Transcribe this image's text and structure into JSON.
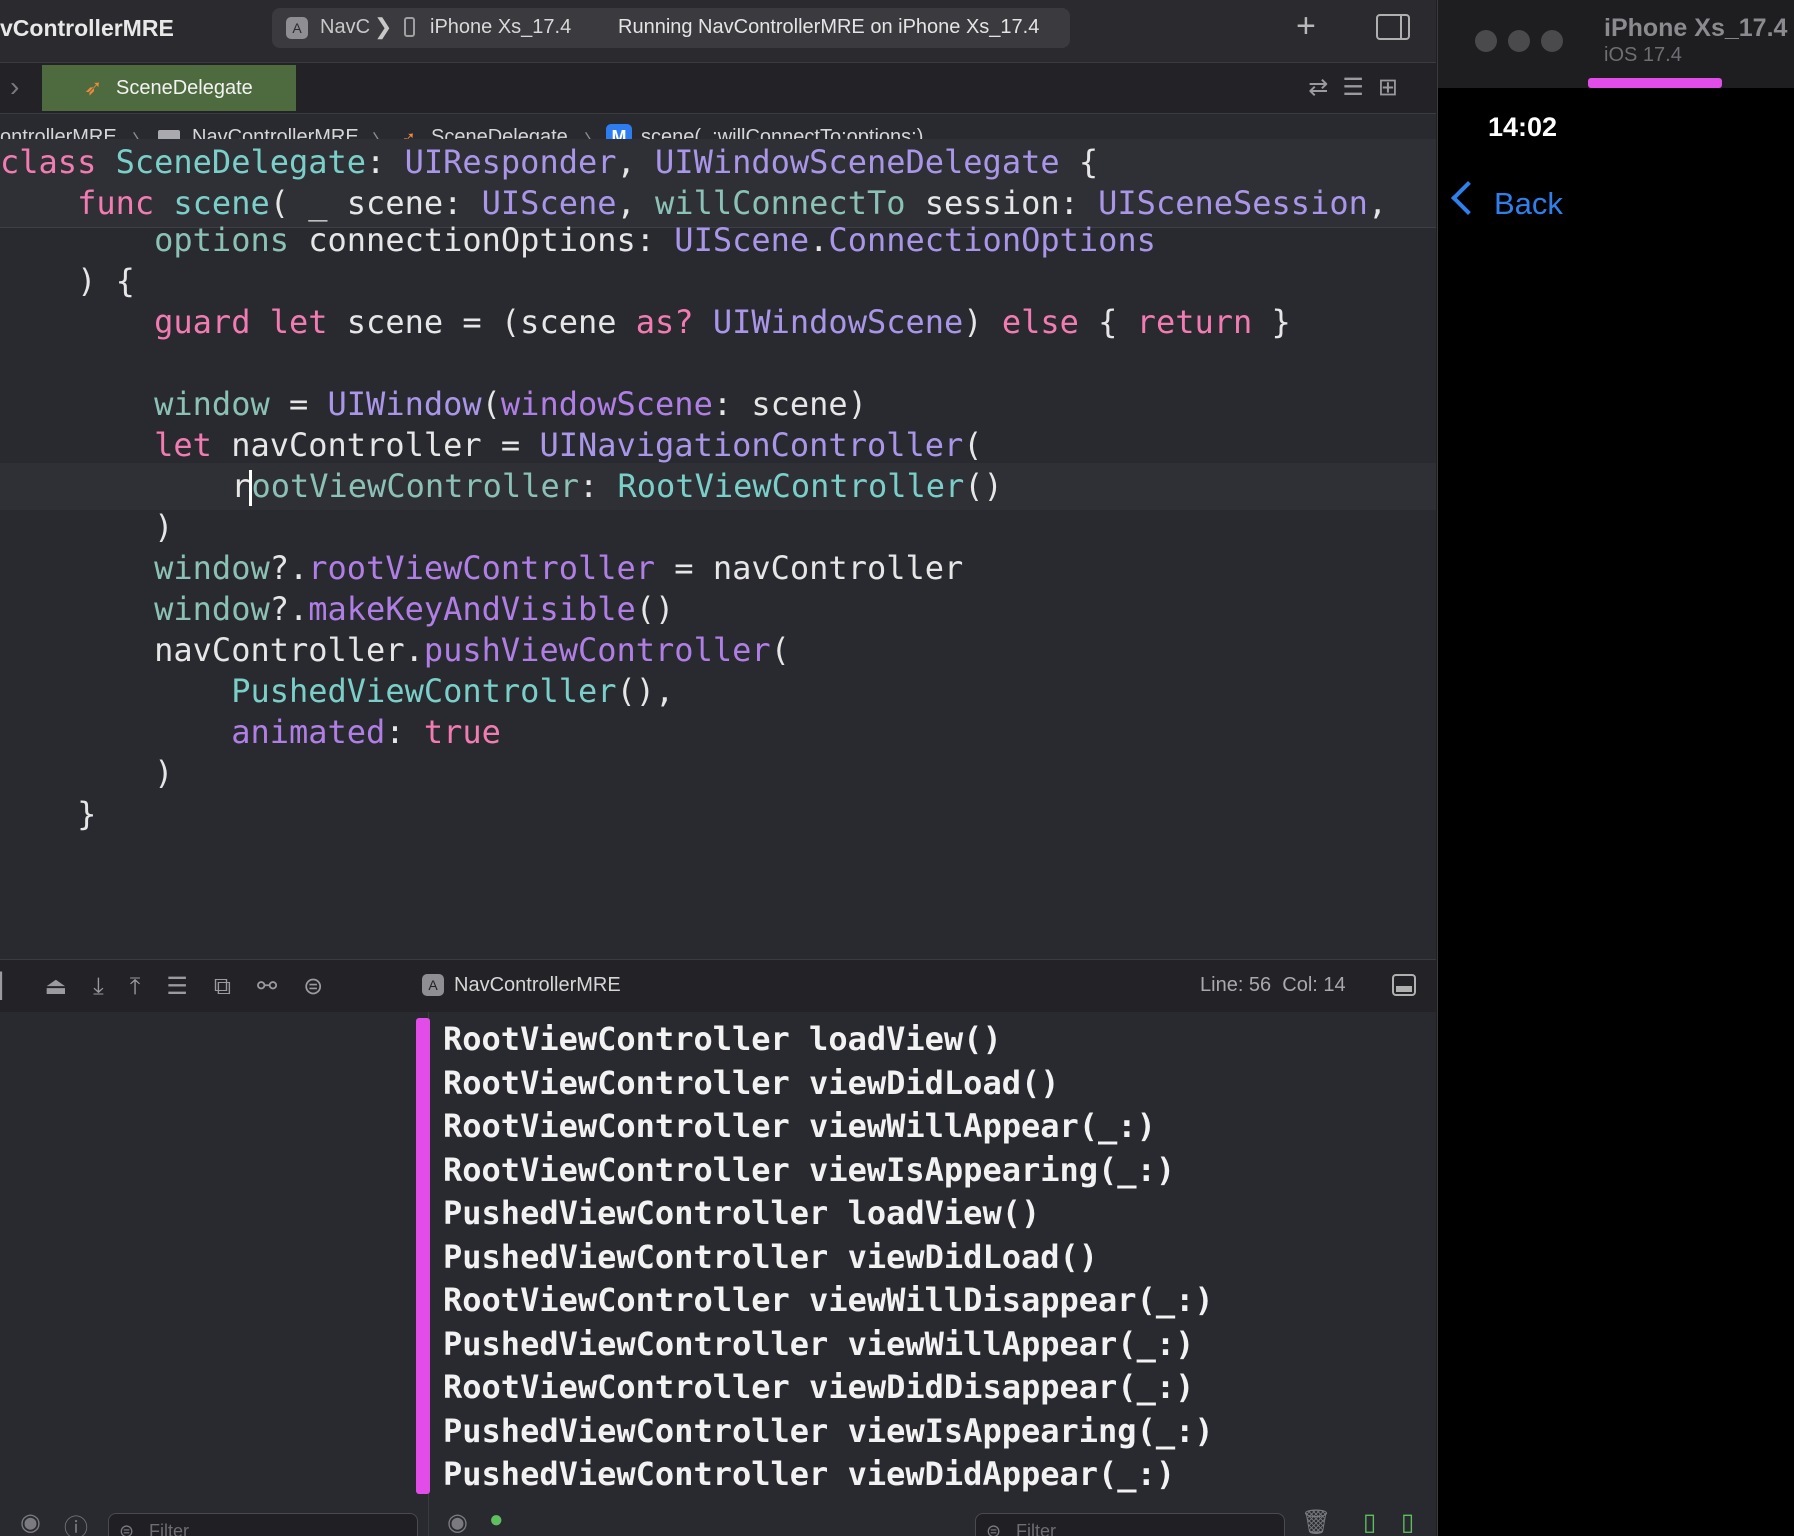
{
  "titlebar": {
    "app_title": "vControllerMRE",
    "scheme": "NavC",
    "scheme_chevron": "❯",
    "destination": "iPhone Xs_17.4",
    "status": "Running NavControllerMRE on iPhone Xs_17.4",
    "icons": [
      "app-scheme-icon",
      "iphone-icon",
      "plus-icon",
      "inspector-toggle-icon"
    ]
  },
  "tabs": {
    "active_tab": "SceneDelegate",
    "active_tab_icon": "swift-icon"
  },
  "jumpbar": {
    "crumbs": [
      "ontrollerMRE",
      "NavControllerMRE",
      "SceneDelegate",
      "scene(_:willConnectTo:options:)"
    ],
    "separator": "〉",
    "method_badge": "M"
  },
  "code": {
    "active_line": 56,
    "lines": [
      [
        [
          "kw",
          "class"
        ],
        [
          "pl",
          " "
        ],
        [
          "ty2",
          "SceneDelegate"
        ],
        [
          "pl",
          ": "
        ],
        [
          "ty",
          "UIResponder"
        ],
        [
          "pl",
          ", "
        ],
        [
          "ty",
          "UIWindowSceneDelegate"
        ],
        [
          "pl",
          " {"
        ]
      ],
      [
        [
          "pl",
          "    "
        ],
        [
          "kw",
          "func"
        ],
        [
          "pl",
          " "
        ],
        [
          "ty2",
          "scene"
        ],
        [
          "pl",
          "( _ scene: "
        ],
        [
          "ty",
          "UIScene"
        ],
        [
          "pl",
          ", "
        ],
        [
          "pr",
          "willConnectTo"
        ],
        [
          "pl",
          " session: "
        ],
        [
          "ty",
          "UISceneSession"
        ],
        [
          "pl",
          ","
        ]
      ],
      [
        [
          "pl",
          "        "
        ],
        [
          "pr",
          "options"
        ],
        [
          "pl",
          " connectionOptions: "
        ],
        [
          "ty",
          "UIScene"
        ],
        [
          "pl",
          "."
        ],
        [
          "ty",
          "ConnectionOptions"
        ]
      ],
      [
        [
          "pl",
          "    ) {"
        ]
      ],
      [
        [
          "pl",
          "        "
        ],
        [
          "kw",
          "guard"
        ],
        [
          "pl",
          " "
        ],
        [
          "kw",
          "let"
        ],
        [
          "pl",
          " scene = (scene "
        ],
        [
          "kw",
          "as?"
        ],
        [
          "pl",
          " "
        ],
        [
          "ty",
          "UIWindowScene"
        ],
        [
          "pl",
          ") "
        ],
        [
          "kw",
          "else"
        ],
        [
          "pl",
          " { "
        ],
        [
          "kw",
          "return"
        ],
        [
          "pl",
          " }"
        ]
      ],
      [
        [
          "pl",
          ""
        ]
      ],
      [
        [
          "pl",
          "        "
        ],
        [
          "pr",
          "window"
        ],
        [
          "pl",
          " = "
        ],
        [
          "ty",
          "UIWindow"
        ],
        [
          "pl",
          "("
        ],
        [
          "mt",
          "windowScene"
        ],
        [
          "pl",
          ": scene)"
        ]
      ],
      [
        [
          "pl",
          "        "
        ],
        [
          "kw",
          "let"
        ],
        [
          "pl",
          " navController = "
        ],
        [
          "ty",
          "UINavigationController"
        ],
        [
          "pl",
          "("
        ]
      ],
      [
        [
          "pl",
          "            r"
        ],
        [
          "cursor",
          ""
        ],
        [
          "pr",
          "ootViewController"
        ],
        [
          "pl",
          ": "
        ],
        [
          "ty2",
          "RootViewController"
        ],
        [
          "pl",
          "()"
        ]
      ],
      [
        [
          "pl",
          "        )"
        ]
      ],
      [
        [
          "pl",
          "        "
        ],
        [
          "pr",
          "window"
        ],
        [
          "pl",
          "?."
        ],
        [
          "mt",
          "rootViewController"
        ],
        [
          "pl",
          " = navController"
        ]
      ],
      [
        [
          "pl",
          "        "
        ],
        [
          "pr",
          "window"
        ],
        [
          "pl",
          "?."
        ],
        [
          "mt",
          "makeKeyAndVisible"
        ],
        [
          "pl",
          "()"
        ]
      ],
      [
        [
          "pl",
          "        navController."
        ],
        [
          "mt",
          "pushViewController"
        ],
        [
          "pl",
          "("
        ]
      ],
      [
        [
          "pl",
          "            "
        ],
        [
          "ty2",
          "PushedViewController"
        ],
        [
          "pl",
          "(),"
        ]
      ],
      [
        [
          "pl",
          "            "
        ],
        [
          "mt",
          "animated"
        ],
        [
          "pl",
          ": "
        ],
        [
          "kw",
          "true"
        ]
      ],
      [
        [
          "pl",
          "        )"
        ]
      ],
      [
        [
          "pl",
          "    }"
        ]
      ]
    ]
  },
  "debugbar": {
    "target": "NavControllerMRE",
    "line_label": "Line: 56",
    "col_label": "Col: 14",
    "icons": [
      "breakpoints-icon",
      "continue-icon",
      "step-over-icon",
      "step-into-icon",
      "step-out-icon",
      "view-hierarchy-icon",
      "memory-graph-icon",
      "environment-icon",
      "location-icon"
    ]
  },
  "console": {
    "lines": [
      "RootViewController loadView()",
      "RootViewController viewDidLoad()",
      "RootViewController viewWillAppear(_:)",
      "RootViewController viewIsAppearing(_:)",
      "PushedViewController loadView()",
      "PushedViewController viewDidLoad()",
      "RootViewController viewWillDisappear(_:)",
      "PushedViewController viewWillAppear(_:)",
      "RootViewController viewDidDisappear(_:)",
      "PushedViewController viewIsAppearing(_:)",
      "PushedViewController viewDidAppear(_:)"
    ],
    "marker_color": "#e24ce8"
  },
  "bottombar": {
    "variables_filter_placeholder": "Filter",
    "console_filter_placeholder": "Filter"
  },
  "simulator": {
    "device_name": "iPhone Xs_17.4",
    "os_version": "iOS 17.4",
    "status_time": "14:02",
    "back_label": "Back",
    "accent_color": "#2f80ed"
  },
  "colors": {
    "keyword": "#f27bb2",
    "type": "#aa96e8",
    "declared_type": "#7ad0c9",
    "property": "#8bc1b6",
    "method": "#b07fe6"
  }
}
